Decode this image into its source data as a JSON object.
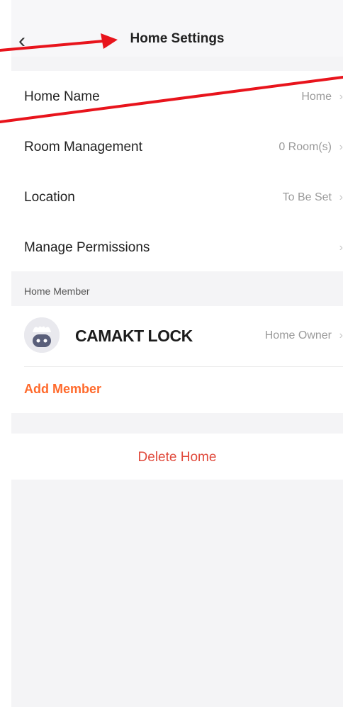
{
  "header": {
    "title": "Home Settings",
    "back_glyph": "‹",
    "back_icon": "chevron-left-icon"
  },
  "settings": {
    "home_name": {
      "label": "Home Name",
      "value": "Home"
    },
    "room_management": {
      "label": "Room Management",
      "value": "0 Room(s)"
    },
    "location": {
      "label": "Location",
      "value": "To Be Set"
    },
    "manage_permissions": {
      "label": "Manage Permissions",
      "value": ""
    },
    "chevron_glyph": "›"
  },
  "members": {
    "section_label": "Home Member",
    "list": [
      {
        "name": "CAMAKT LOCK",
        "role": "Home Owner",
        "avatar_icon": "robot-avatar-icon"
      }
    ],
    "add_label": "Add Member"
  },
  "actions": {
    "delete_label": "Delete Home"
  },
  "colors": {
    "accent_orange": "#ff6a2c",
    "danger_red": "#e0493b",
    "annotation_red": "#e8141c",
    "background": "#f4f4f6"
  }
}
